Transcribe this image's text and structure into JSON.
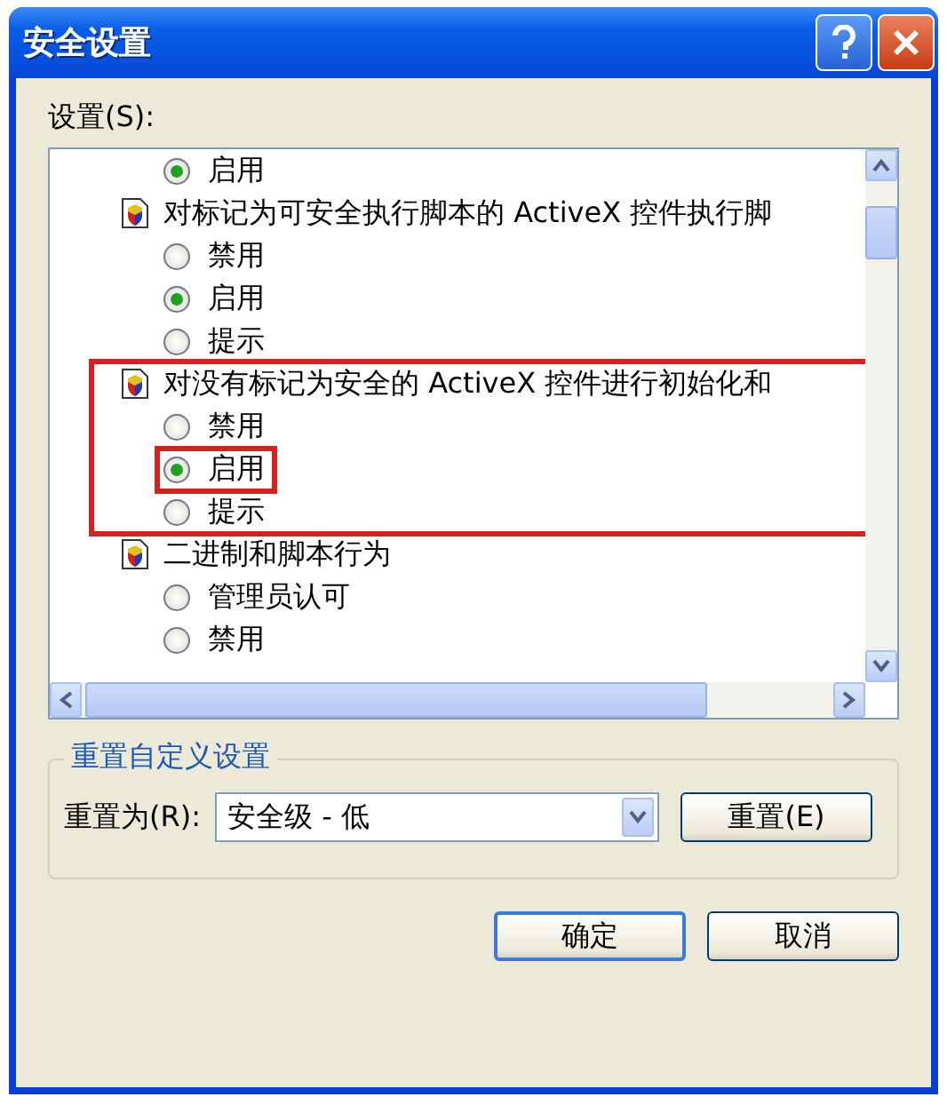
{
  "window": {
    "title": "安全设置"
  },
  "settings_label": "设置(S):",
  "settings_list": [
    {
      "kind": "radio",
      "label": "启用",
      "selected": true,
      "highlighted": false
    },
    {
      "kind": "setting",
      "label": "对标记为可安全执行脚本的 ActiveX 控件执行脚",
      "highlighted": false,
      "children": [
        {
          "kind": "radio",
          "label": "禁用",
          "selected": false,
          "highlighted": false
        },
        {
          "kind": "radio",
          "label": "启用",
          "selected": true,
          "highlighted": false
        },
        {
          "kind": "radio",
          "label": "提示",
          "selected": false,
          "highlighted": false
        }
      ]
    },
    {
      "kind": "setting",
      "label": "对没有标记为安全的 ActiveX 控件进行初始化和",
      "highlighted": true,
      "children": [
        {
          "kind": "radio",
          "label": "禁用",
          "selected": false,
          "highlighted": false
        },
        {
          "kind": "radio",
          "label": "启用",
          "selected": true,
          "highlighted": true
        },
        {
          "kind": "radio",
          "label": "提示",
          "selected": false,
          "highlighted": false
        }
      ]
    },
    {
      "kind": "setting",
      "label": "二进制和脚本行为",
      "highlighted": false,
      "children": [
        {
          "kind": "radio",
          "label": "管理员认可",
          "selected": false,
          "highlighted": false
        },
        {
          "kind": "radio",
          "label": "禁用",
          "selected": false,
          "highlighted": false
        }
      ]
    }
  ],
  "reset_group": {
    "title": "重置自定义设置",
    "label": "重置为(R):",
    "dropdown_value": "安全级 - 低",
    "reset_button": "重置(E)"
  },
  "buttons": [
    {
      "label": "确定",
      "default": true
    },
    {
      "label": "取消",
      "default": false
    }
  ]
}
